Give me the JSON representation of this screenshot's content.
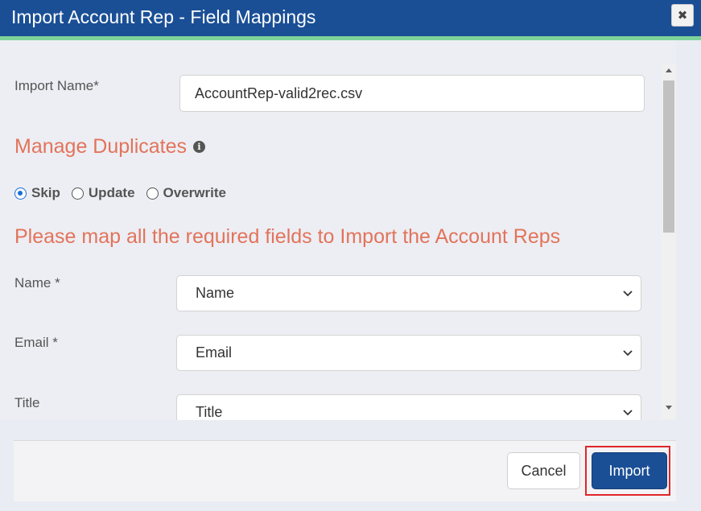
{
  "dialog": {
    "title": "Import Account Rep - Field Mappings",
    "close_glyph": "✖"
  },
  "form": {
    "import_name_label": "Import Name*",
    "import_name_value": "AccountRep-valid2rec.csv",
    "manage_duplicates_heading": "Manage Duplicates",
    "info_glyph": "i",
    "duplicates_options": [
      {
        "label": "Skip",
        "selected": true
      },
      {
        "label": "Update",
        "selected": false
      },
      {
        "label": "Overwrite",
        "selected": false
      }
    ],
    "mapping_heading": "Please map all the required fields to Import the Account Reps",
    "mappings": [
      {
        "label": "Name *",
        "selected": "Name"
      },
      {
        "label": "Email *",
        "selected": "Email"
      },
      {
        "label": "Title",
        "selected": "Title"
      }
    ]
  },
  "footer": {
    "cancel_label": "Cancel",
    "import_label": "Import"
  },
  "colors": {
    "title_bar": "#1a4f96",
    "accent_heading": "#e3735a",
    "highlight": "#e0262a"
  },
  "icons": [
    "close-icon",
    "info-icon",
    "chevron-down-icon"
  ]
}
